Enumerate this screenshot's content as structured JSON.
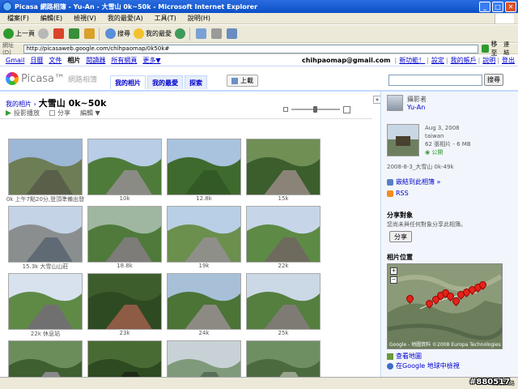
{
  "window": {
    "title": "Picasa 網路相簿 - Yu-An - 大雪山 0k~50k - Microsoft Internet Explorer",
    "min": "_",
    "max": "□",
    "close": "✕"
  },
  "menubar": {
    "items": [
      "檔案(F)",
      "編輯(E)",
      "檢視(V)",
      "我的最愛(A)",
      "工具(T)",
      "說明(H)"
    ]
  },
  "toolbar": {
    "back_label": "上一頁",
    "search_label": "搜尋",
    "favorites_label": "我的最愛"
  },
  "address": {
    "label": "網址(D)",
    "url": "http://picasaweb.google.com/chihpaomap/0k50k#",
    "go_label": "移至",
    "links_label": "連結"
  },
  "gbar": {
    "items": [
      "Gmail",
      "日曆",
      "文件",
      "相片",
      "閱讀器",
      "所有網頁",
      "更多▼"
    ],
    "current_index": 3,
    "email": "chihpaomap@gmail.com",
    "right_links": [
      "新功能！",
      "設定",
      "我的帳戶",
      "說明",
      "登出"
    ]
  },
  "picasa": {
    "logo_text": "Picasa™",
    "logo_sub": "網路相簿",
    "tabs": [
      "我的相片",
      "我的最愛",
      "探索"
    ],
    "active_tab": 0,
    "upload_label": "上載",
    "search_button": "搜尋"
  },
  "album": {
    "breadcrumb": "我的相片 ›",
    "title": "大雪山 0k~50k",
    "actions": [
      "投影播放",
      "分享",
      "編輯 ▼"
    ]
  },
  "photos": [
    {
      "caption": "0k 上午7點20分,登頂準備出發",
      "colors": [
        "#9db7d6",
        "#6d7d55",
        "#5a5f4a"
      ]
    },
    {
      "caption": "10k",
      "colors": [
        "#b9cde6",
        "#4f7b3a",
        "#8b8b86"
      ]
    },
    {
      "caption": "12.8k",
      "colors": [
        "#a9c2de",
        "#3f6a2e",
        "#335a26"
      ]
    },
    {
      "caption": "15k",
      "colors": [
        "#6f8f55",
        "#3c5d2c",
        "#8a8478"
      ]
    },
    {
      "caption": "15.3k 大雪山山莊",
      "colors": [
        "#c4d3e6",
        "#8a8e8f",
        "#5f6a74"
      ]
    },
    {
      "caption": "18.8k",
      "colors": [
        "#9fb7a0",
        "#4f7a3b",
        "#7d7c78"
      ]
    },
    {
      "caption": "19k",
      "colors": [
        "#b8cfe6",
        "#6b8f4d",
        "#8f8f8a"
      ]
    },
    {
      "caption": "22k",
      "colors": [
        "#c6d6e8",
        "#5d8a45",
        "#6e6a5e"
      ]
    },
    {
      "caption": "22k 休息站",
      "colors": [
        "#d7e2ee",
        "#5f8a46",
        "#707070"
      ]
    },
    {
      "caption": "23k",
      "colors": [
        "#3d5e2c",
        "#2e4a22",
        "#8e5b44"
      ]
    },
    {
      "caption": "24k",
      "colors": [
        "#a7c0d8",
        "#4b7436",
        "#8c8a82"
      ]
    },
    {
      "caption": "25k",
      "colors": [
        "#cbd8e6",
        "#547f3f",
        "#7e7b74"
      ]
    },
    {
      "caption": "",
      "colors": [
        "#6b8d5a",
        "#3e5f30",
        "#88888a"
      ]
    },
    {
      "caption": "",
      "colors": [
        "#486b34",
        "#2d4a20",
        "#1f2a18"
      ]
    },
    {
      "caption": "",
      "colors": [
        "#c8d2d6",
        "#7e9a7a",
        "#596e57"
      ]
    },
    {
      "caption": "",
      "colors": [
        "#6e8f62",
        "#4b6b3f",
        "#9aa48e"
      ]
    }
  ],
  "sidebar": {
    "owner_label": "攝影者",
    "owner_name": "Yu-An",
    "album_date": "Aug 3, 2008",
    "album_location": "taiwan",
    "album_stats": "62 張相片 - 6 MB",
    "album_visibility": "公開",
    "album_caption": "2008-8-3_大雪山 0k-49k",
    "embed_link": "嵌結到此相簿 »",
    "rss_link": "RSS",
    "share_heading": "分享對象",
    "share_note": "您尚未與任何對象分享此相簿。",
    "share_button": "分享",
    "location_heading": "相片位置",
    "map_attr": "Google - 地圖資料 ©2008 Europa Technologies",
    "view_map_link": "查看地圖",
    "google_earth_link": "在Google 地球中檢視"
  },
  "status": {
    "zone": "網際網路"
  },
  "watermark": "#880517"
}
